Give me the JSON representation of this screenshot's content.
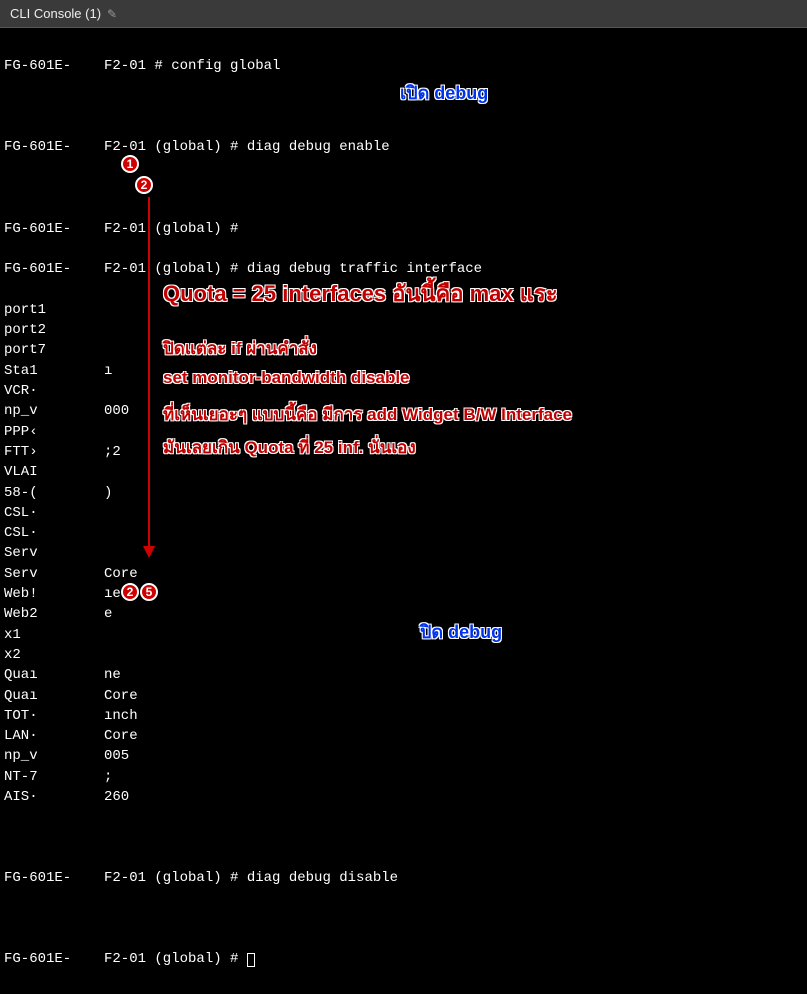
{
  "titlebar": {
    "text": "CLI Console (1)"
  },
  "prompt": {
    "host": "FG-601E-",
    "ctx_base": "F2-01 #",
    "ctx_global": "F2-01 (global) #"
  },
  "cmds": {
    "config_global": "config global",
    "diag_enable": "diag debug enable",
    "diag_traffic": "diag debug traffic interface",
    "diag_disable": "diag debug disable"
  },
  "rows": [
    {
      "c0": "port1",
      "c1": ""
    },
    {
      "c0": "port2",
      "c1": ""
    },
    {
      "c0": "port7",
      "c1": ""
    },
    {
      "c0": "Sta1",
      "c1": "ı"
    },
    {
      "c0": "VCR·",
      "c1": ""
    },
    {
      "c0": "np_v",
      "c1": "000"
    },
    {
      "c0": "PPP‹",
      "c1": ""
    },
    {
      "c0": "FTT›",
      "c1": ";2"
    },
    {
      "c0": "VLAI",
      "c1": ""
    },
    {
      "c0": "58-(",
      "c1": ")"
    },
    {
      "c0": "CSL·",
      "c1": ""
    },
    {
      "c0": "CSL·",
      "c1": ""
    },
    {
      "c0": "Serv",
      "c1": ""
    },
    {
      "c0": "Serv",
      "c1": "Core"
    },
    {
      "c0": "Web!",
      "c1": "ıe"
    },
    {
      "c0": "Web2",
      "c1": "e"
    },
    {
      "c0": "x1",
      "c1": ""
    },
    {
      "c0": "x2",
      "c1": ""
    },
    {
      "c0": "Quaı",
      "c1": "ne"
    },
    {
      "c0": "Quaı",
      "c1": "Core"
    },
    {
      "c0": "TOT·",
      "c1": "ınch"
    },
    {
      "c0": "LAN·",
      "c1": "Core"
    },
    {
      "c0": "np_v",
      "c1": "005"
    },
    {
      "c0": "NT-7",
      "c1": ";"
    },
    {
      "c0": "AIS·",
      "c1": "260"
    }
  ],
  "annotations": {
    "open_debug": "เปิด debug",
    "close_debug": "ปิด debug",
    "quota_head": "Quota = 25 interfaces  อันนี้คือ max แระ",
    "line1": "ปิดแต่ละ if ผ่านคำสั่ง",
    "line2": "set monitor-bandwidth disable",
    "line3": "ที่เห็นเยอะๆ แบบนี้คือ มีการ add Widget B/W Interface",
    "line4": "มันเลยเกิน Quota ที่ 25 inf. นั่นเอง"
  },
  "markers": {
    "m1": "1",
    "m2": "2",
    "m25a": "2",
    "m25b": "5"
  }
}
